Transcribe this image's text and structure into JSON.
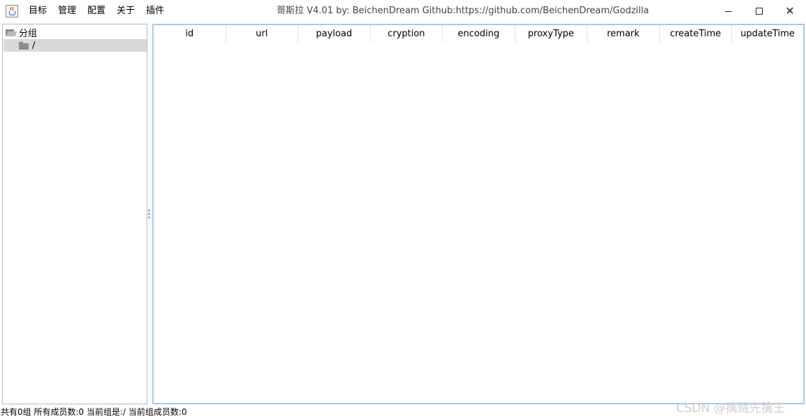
{
  "window": {
    "title": "哥斯拉    V4.01 by: BeichenDream Github:https://github.com/BeichenDream/Godzilla",
    "minimize_label": "",
    "maximize_label": "",
    "close_label": "✕"
  },
  "menu": {
    "items": [
      {
        "label": "目标"
      },
      {
        "label": "管理"
      },
      {
        "label": "配置"
      },
      {
        "label": "关于"
      },
      {
        "label": "插件"
      }
    ]
  },
  "tree": {
    "root_label": "分组",
    "child_label": "/",
    "selected": "/"
  },
  "table": {
    "columns": [
      "id",
      "url",
      "payload",
      "cryption",
      "encoding",
      "proxyType",
      "remark",
      "createTime",
      "updateTime"
    ],
    "rows": []
  },
  "status": {
    "text": "共有0组 所有成员数:0 当前组是:/ 当前组成员数:0"
  },
  "watermark": {
    "text": "CSDN @擒贼先擒王"
  },
  "colors": {
    "table_border": "#a6c8ec",
    "selection_bg": "#d9d9d9"
  }
}
